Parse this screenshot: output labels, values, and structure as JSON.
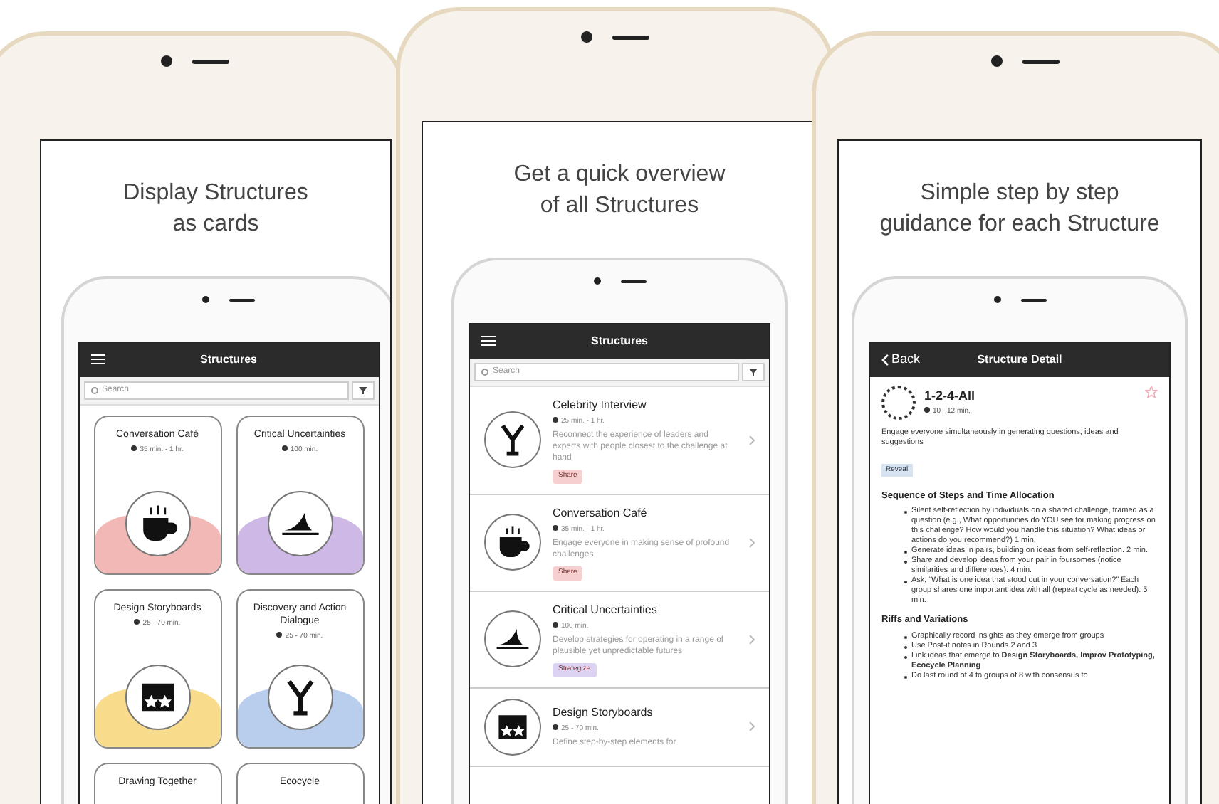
{
  "panels": [
    {
      "kind": "cards",
      "caption": [
        "Display Structures",
        "as cards"
      ],
      "app": {
        "title": "Structures",
        "search_placeholder": "Search",
        "cards": [
          {
            "name": "Conversation Café",
            "duration": "35 min. - 1 hr.",
            "color": "#f2b8b5"
          },
          {
            "name": "Critical Uncertainties",
            "duration": "100 min.",
            "color": "#cdb8e6"
          },
          {
            "name": "Design Storyboards",
            "duration": "25 - 70 min.",
            "color": "#f8dc8c"
          },
          {
            "name": "Discovery and Action Dialogue",
            "duration": "25 - 70 min.",
            "color": "#b9cdec"
          },
          {
            "name": "Drawing Together"
          },
          {
            "name": "Ecocycle"
          }
        ]
      }
    },
    {
      "kind": "list",
      "caption": [
        "Get a quick overview",
        "of all Structures"
      ],
      "app": {
        "title": "Structures",
        "search_placeholder": "Search",
        "rows": [
          {
            "name": "Celebrity Interview",
            "duration": "25 min. - 1 hr.",
            "description": "Reconnect the experience of leaders and experts with people closest to the challenge at hand",
            "tag": "Share",
            "color": "#f6d0d0"
          },
          {
            "name": "Conversation Café",
            "duration": "35 min. - 1 hr.",
            "description": "Engage everyone in making sense of profound challenges",
            "tag": "Share",
            "color": "#f6d0d0"
          },
          {
            "name": "Critical Uncertainties",
            "duration": "100 min.",
            "description": "Develop strategies for operating in a range of plausible yet unpredictable futures",
            "tag": "Strategize",
            "color": "#dcd3f2"
          },
          {
            "name": "Design Storyboards",
            "duration": "25 - 70 min.",
            "description": "Define step-by-step elements for"
          }
        ]
      }
    },
    {
      "kind": "detail",
      "caption": [
        "Simple step by step",
        "guidance for each Structure"
      ],
      "app": {
        "back": "Back",
        "title": "Structure Detail",
        "name": "1-2-4-All",
        "duration": "10 - 12 min.",
        "description": "Engage everyone simultaneously in generating questions, ideas and suggestions",
        "tag": "Reveal",
        "sections": [
          {
            "heading": "Sequence of Steps and Time Allocation",
            "items": [
              "Silent self-reflection by individuals on a shared challenge, framed as a question (e.g., What opportunities do YOU see for making progress on this challenge? How would you handle this situation? What ideas or actions do you recommend?) 1 min.",
              "Generate ideas in pairs, building on ideas from self-reflection. 2 min.",
              "Share and develop ideas from your pair in foursomes (notice similarities and differences). 4 min.",
              "Ask, “What is one idea that stood out in your conversation?” Each group shares one important idea with all (repeat cycle as needed). 5 min."
            ]
          },
          {
            "heading": "Riffs and Variations",
            "items": [
              "Graphically record insights as they emerge from groups",
              "Use Post-it notes in Rounds 2 and 3",
              "Link ideas that emerge to **Design Storyboards, Improv Prototyping, Ecocycle Planning**",
              "Do last round of 4 to groups of 8 with consensus to"
            ]
          }
        ]
      }
    }
  ]
}
